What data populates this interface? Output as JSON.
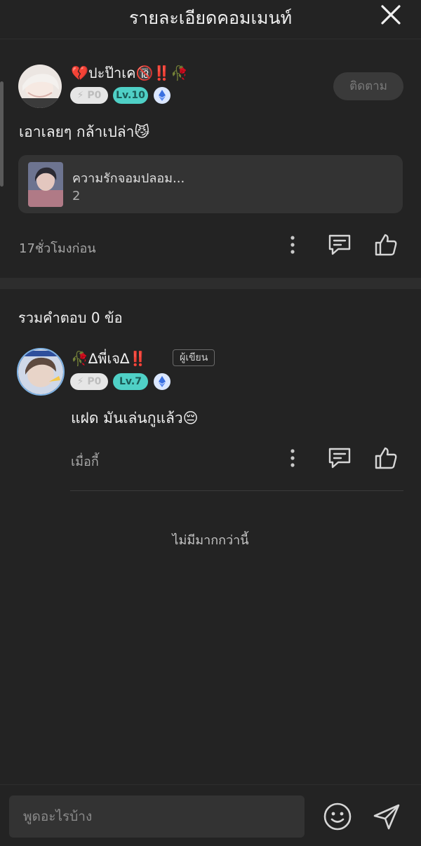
{
  "header": {
    "title": "รายละเอียดคอมเมนท์"
  },
  "comment": {
    "username": "ปะป๊าเค",
    "emoji_prefix": "💔",
    "emoji_suffix": "🔞‼️🥀",
    "badge_p": "P0",
    "badge_level": "Lv.10",
    "follow_label": "ติดตาม",
    "text": "เอาเลยๆ กล้าเปล่า😼",
    "card": {
      "title": "ความรักจอมปลอม...",
      "count": "2"
    },
    "time": "17ชั่วโมงก่อน"
  },
  "replies": {
    "title": "รวมคำตอบ 0 ข้อ",
    "items": [
      {
        "username": "∆พี่เจ∆",
        "emoji_prefix": "🥀",
        "emoji_suffix": "‼️",
        "author_tag": "ผู้เขียน",
        "badge_p": "P0",
        "badge_level": "Lv.7",
        "text": "แฝด มันเล่นกูแล้ว😔",
        "time": "เมื่อกี้"
      }
    ],
    "no_more": "ไม่มีมากกว่านี้"
  },
  "input": {
    "placeholder": "พูดอะไรบ้าง"
  },
  "colors": {
    "background": "#232323",
    "level_badge": "#4fd0c6",
    "card": "#333333"
  },
  "icons": [
    "close-icon",
    "more-vertical-icon",
    "comment-icon",
    "thumbs-up-icon",
    "eth-diamond-icon",
    "lightning-icon",
    "smiley-icon",
    "send-icon"
  ]
}
